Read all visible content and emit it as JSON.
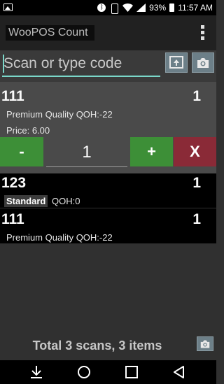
{
  "status_bar": {
    "battery_percent": "93%",
    "time": "11:57 AM",
    "icons": [
      "image-icon",
      "bluetooth-icon",
      "vibrate-icon",
      "wifi-icon",
      "signal-icon",
      "battery-icon"
    ]
  },
  "app_bar": {
    "title": "WooPOS Count",
    "overflow_icon": "more-vert-icon"
  },
  "search": {
    "placeholder": "Scan or type code",
    "value": "",
    "upload_icon": "image-upload-icon",
    "camera_icon": "camera-icon"
  },
  "selected_item": {
    "code": "111",
    "quantity": "1",
    "description": "Premium Quality QOH:-22",
    "price": "Price: 6.00",
    "minus_label": "-",
    "stepper_value": "1",
    "plus_label": "+",
    "remove_label": "X"
  },
  "items": [
    {
      "code": "123",
      "quantity": "1",
      "badge": "Standard",
      "description": "QOH:0"
    },
    {
      "code": "111",
      "quantity": "1",
      "description": "Premium Quality QOH:-22"
    }
  ],
  "footer": {
    "total": "Total 3 scans, 3 items",
    "camera_icon": "camera-icon"
  },
  "nav_bar": {
    "icons": [
      "download-icon",
      "home-circle-icon",
      "recents-square-icon",
      "back-triangle-icon"
    ]
  },
  "colors": {
    "accent": "#7ad7c9",
    "plus": "#3d8f37",
    "remove": "#8a2a37",
    "icon_button": "#6c7f88"
  }
}
